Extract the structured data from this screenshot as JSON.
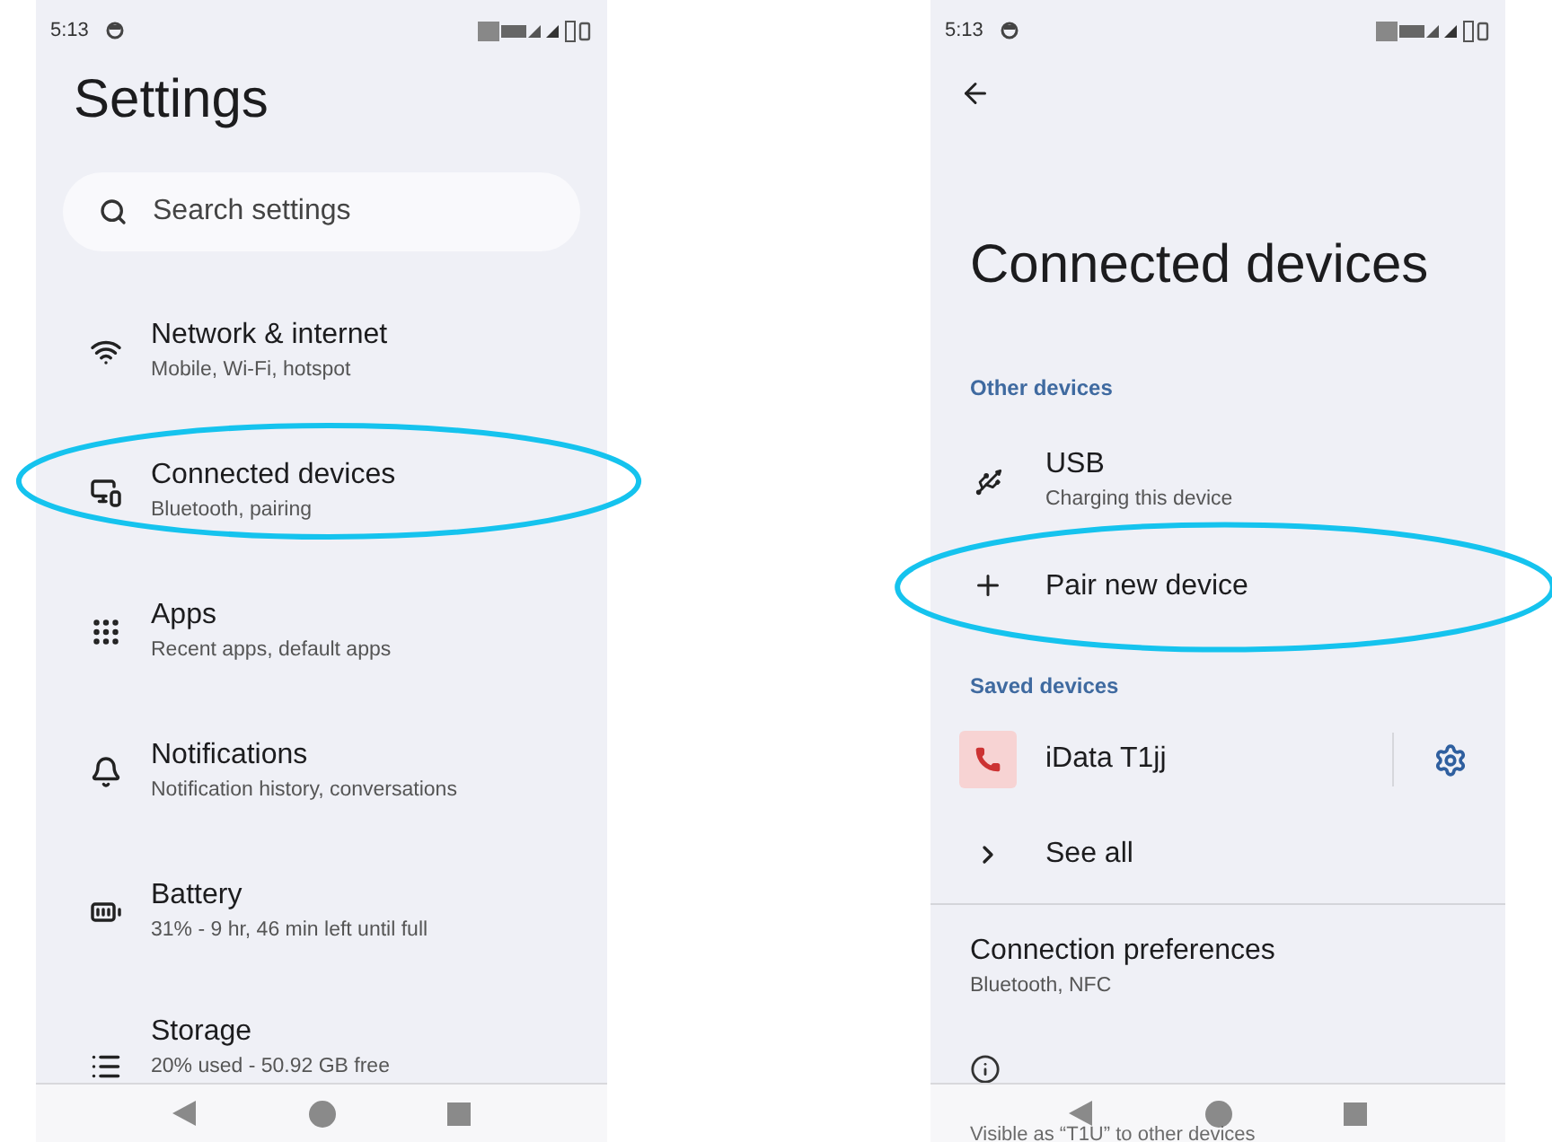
{
  "screens": [
    {
      "status_bar": {
        "time": "5:13"
      },
      "title": "Settings",
      "search": {
        "placeholder": "Search settings"
      },
      "items": [
        {
          "title": "Network & internet",
          "subtitle": "Mobile, Wi-Fi, hotspot",
          "highlighted": false
        },
        {
          "title": "Connected devices",
          "subtitle": "Bluetooth, pairing",
          "highlighted": true
        },
        {
          "title": "Apps",
          "subtitle": "Recent apps, default apps",
          "highlighted": false
        },
        {
          "title": "Notifications",
          "subtitle": "Notification history, conversations",
          "highlighted": false
        },
        {
          "title": "Battery",
          "subtitle": "31% - 9 hr, 46 min left until full",
          "highlighted": false
        },
        {
          "title": "Storage",
          "subtitle": "20% used - 50.92 GB free",
          "highlighted": false
        }
      ]
    },
    {
      "status_bar": {
        "time": "5:13"
      },
      "title": "Connected devices",
      "sections": [
        {
          "header": "Other devices",
          "items": [
            {
              "kind": "usb",
              "title": "USB",
              "subtitle": "Charging this device",
              "highlighted": false
            },
            {
              "kind": "add",
              "title": "Pair new device",
              "highlighted": true
            }
          ]
        },
        {
          "header": "Saved devices",
          "items": [
            {
              "kind": "saved",
              "title": "iData T1jj",
              "highlighted": false
            },
            {
              "kind": "more",
              "title": "See all",
              "highlighted": false
            }
          ]
        }
      ],
      "preferences": {
        "title": "Connection preferences",
        "subtitle": "Bluetooth, NFC"
      },
      "footer_text": "Visible as “T1U” to other devices"
    }
  ]
}
